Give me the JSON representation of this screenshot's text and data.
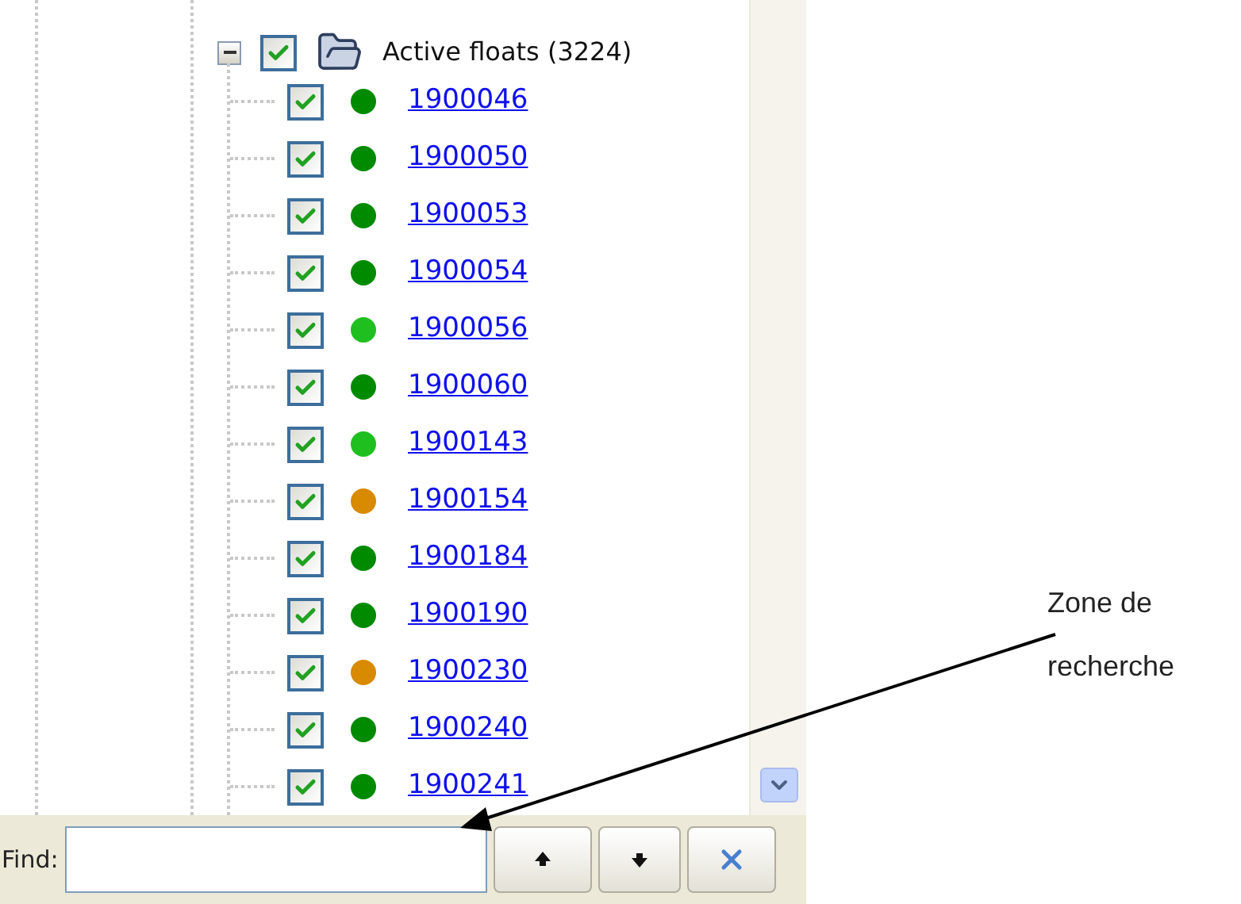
{
  "tree": {
    "label": "Active floats (3224)",
    "expanded": true,
    "checked": true,
    "children": [
      {
        "label": "1900046",
        "checked": true,
        "color": "#008a00"
      },
      {
        "label": "1900050",
        "checked": true,
        "color": "#008a00"
      },
      {
        "label": "1900053",
        "checked": true,
        "color": "#008a00"
      },
      {
        "label": "1900054",
        "checked": true,
        "color": "#008a00"
      },
      {
        "label": "1900056",
        "checked": true,
        "color": "#1fbf1f"
      },
      {
        "label": "1900060",
        "checked": true,
        "color": "#008a00"
      },
      {
        "label": "1900143",
        "checked": true,
        "color": "#1fbf1f"
      },
      {
        "label": "1900154",
        "checked": true,
        "color": "#d88a00"
      },
      {
        "label": "1900184",
        "checked": true,
        "color": "#008a00"
      },
      {
        "label": "1900190",
        "checked": true,
        "color": "#008a00"
      },
      {
        "label": "1900230",
        "checked": true,
        "color": "#d88a00"
      },
      {
        "label": "1900240",
        "checked": true,
        "color": "#008a00"
      },
      {
        "label": "1900241",
        "checked": true,
        "color": "#008a00"
      }
    ]
  },
  "find": {
    "label": "Find:"
  },
  "annotation": {
    "text": "Zone de recherche"
  }
}
